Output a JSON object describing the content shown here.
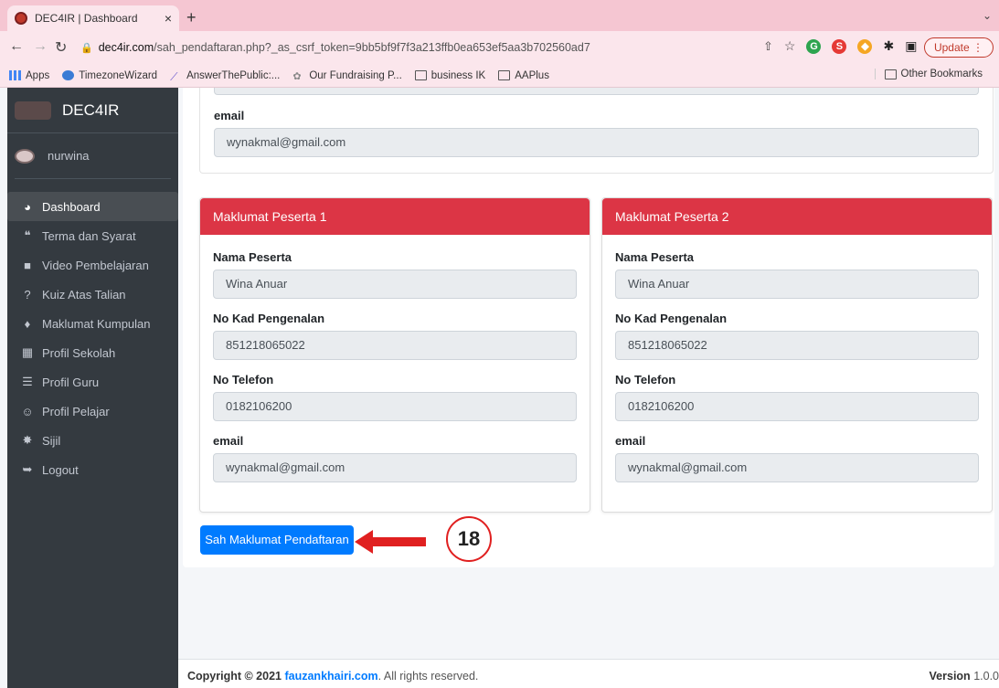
{
  "browser": {
    "tab_title": "DEC4IR | Dashboard",
    "tab_close": "×",
    "new_tab": "+",
    "tab_menu": "⌄",
    "url_domain": "dec4ir.com",
    "url_path": "/sah_pendaftaran.php?_as_csrf_token=9bb5bf9f7f3a213ffb0ea653ef5aa3b702560ad7",
    "update_label": "Update",
    "bookmarks": [
      "Apps",
      "TimezoneWizard",
      "AnswerThePublic:...",
      "Our Fundraising P...",
      "business IK",
      "AAPlus"
    ],
    "other_bookmarks": "Other Bookmarks"
  },
  "sidebar": {
    "brand": "DEC4IR",
    "user": "nurwina",
    "items": [
      {
        "label": "Dashboard",
        "icon": "tachometer-icon",
        "glyph": "◕"
      },
      {
        "label": "Terma dan Syarat",
        "icon": "quote-icon",
        "glyph": "❝"
      },
      {
        "label": "Video Pembelajaran",
        "icon": "video-icon",
        "glyph": "■"
      },
      {
        "label": "Kuiz Atas Talian",
        "icon": "question-icon",
        "glyph": "?"
      },
      {
        "label": "Maklumat Kumpulan",
        "icon": "tint-icon",
        "glyph": "♦"
      },
      {
        "label": "Profil Sekolah",
        "icon": "building-icon",
        "glyph": "▦"
      },
      {
        "label": "Profil Guru",
        "icon": "server-icon",
        "glyph": "☰"
      },
      {
        "label": "Profil Pelajar",
        "icon": "user-circle-icon",
        "glyph": "☺"
      },
      {
        "label": "Sijil",
        "icon": "certificate-icon",
        "glyph": "✸"
      },
      {
        "label": "Logout",
        "icon": "sign-out-icon",
        "glyph": "➥"
      }
    ]
  },
  "top_card": {
    "email_label": "email",
    "email_value": "wynakmal@gmail.com"
  },
  "peserta": [
    {
      "header": "Maklumat Peserta 1",
      "nama_label": "Nama Peserta",
      "nama": "Wina Anuar",
      "ic_label": "No Kad Pengenalan",
      "ic": "851218065022",
      "tel_label": "No Telefon",
      "tel": "0182106200",
      "email_label": "email",
      "email": "wynakmal@gmail.com"
    },
    {
      "header": "Maklumat Peserta 2",
      "nama_label": "Nama Peserta",
      "nama": "Wina Anuar",
      "ic_label": "No Kad Pengenalan",
      "ic": "851218065022",
      "tel_label": "No Telefon",
      "tel": "0182106200",
      "email_label": "email",
      "email": "wynakmal@gmail.com"
    }
  ],
  "submit_label": "Sah Maklumat Pendaftaran",
  "annotation": "18",
  "footer": {
    "copyright": "Copyright © 2021",
    "link": "fauzankhairi.com",
    "rights": ". All rights reserved.",
    "version_label": "Version",
    "version": "1.0.0"
  },
  "colors": {
    "accent": "#007bff",
    "card_header": "#dc3545",
    "sidebar": "#343a40",
    "annotation": "#e02020"
  }
}
